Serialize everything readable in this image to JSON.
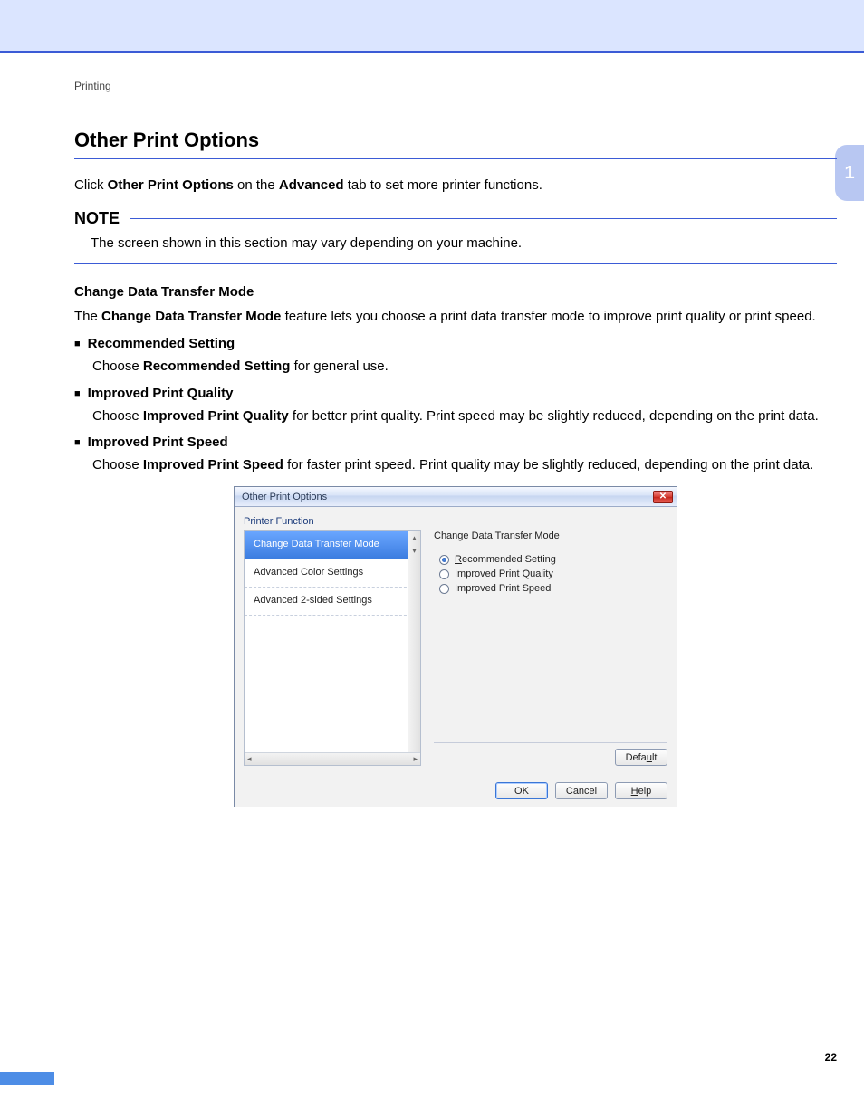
{
  "runningHead": "Printing",
  "chapterTab": "1",
  "pageNumber": "22",
  "heading": "Other Print Options",
  "intro": {
    "pre": "Click ",
    "bold1": "Other Print Options",
    "mid": " on the ",
    "bold2": "Advanced",
    "post": " tab to set more printer functions."
  },
  "note": {
    "label": "NOTE",
    "body": "The screen shown in this section may vary depending on your machine."
  },
  "subhead1": "Change Data Transfer Mode",
  "subhead1_desc": {
    "pre": "The ",
    "bold": "Change Data Transfer Mode",
    "post": " feature lets you choose a print data transfer mode to improve print quality or print speed."
  },
  "bullets": [
    {
      "title": "Recommended Setting",
      "desc_pre": "Choose ",
      "desc_bold": "Recommended Setting",
      "desc_post": " for general use."
    },
    {
      "title": "Improved Print Quality",
      "desc_pre": "Choose ",
      "desc_bold": "Improved Print Quality",
      "desc_post": " for better print quality. Print speed may be slightly reduced, depending on the print data."
    },
    {
      "title": "Improved Print Speed",
      "desc_pre": "Choose ",
      "desc_bold": "Improved Print Speed",
      "desc_post": " for faster print speed. Print quality may be slightly reduced, depending on the print data."
    }
  ],
  "dialog": {
    "title": "Other Print Options",
    "groupLabel": "Printer Function",
    "listItems": [
      "Change Data Transfer Mode",
      "Advanced Color Settings",
      "Advanced 2-sided Settings"
    ],
    "selectedIndex": 0,
    "panelTitle": "Change Data Transfer Mode",
    "radios": [
      {
        "pre": "R",
        "rest": "ecommended Setting",
        "checked": true
      },
      {
        "pre": "",
        "rest": "Improved Print Quality",
        "checked": false
      },
      {
        "pre": "",
        "rest": "Improved Print Speed",
        "checked": false
      }
    ],
    "defaultBtn": {
      "pre": "Defa",
      "u": "u",
      "post": "lt"
    },
    "ok": "OK",
    "cancel": "Cancel",
    "help": {
      "u": "H",
      "rest": "elp"
    }
  }
}
